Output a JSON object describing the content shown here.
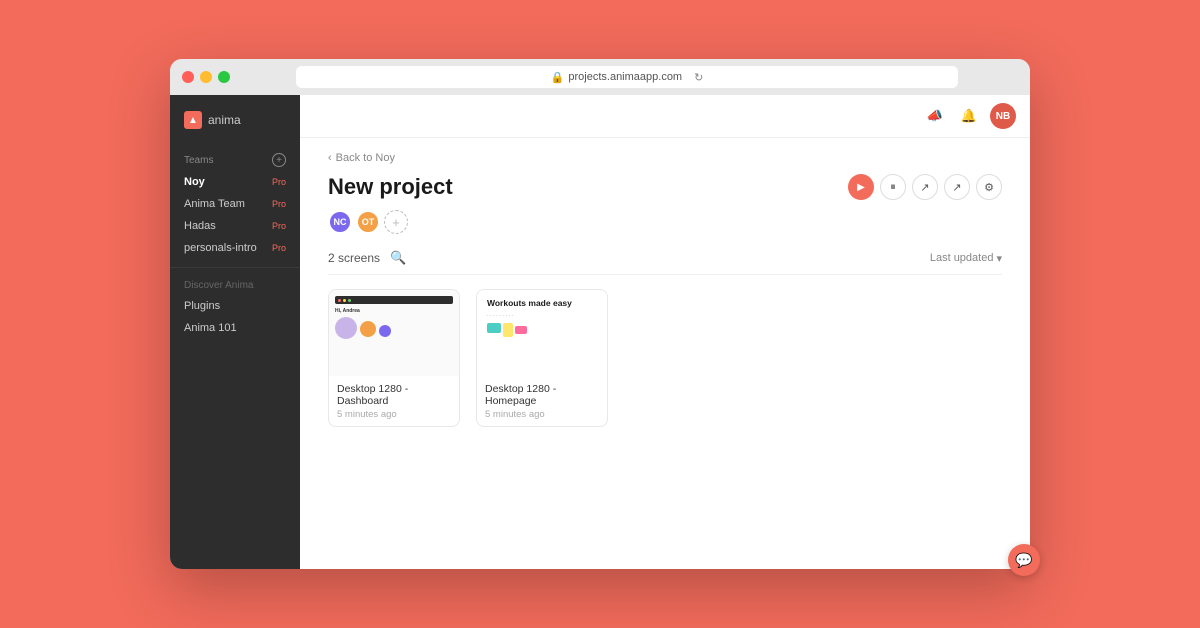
{
  "browser": {
    "url": "projects.animaapp.com",
    "traffic_lights": [
      "red",
      "yellow",
      "green"
    ]
  },
  "sidebar": {
    "logo_text": "anima",
    "teams_label": "Teams",
    "add_btn": "+",
    "items": [
      {
        "label": "Noy",
        "badge": "Pro",
        "active": true
      },
      {
        "label": "Anima Team",
        "badge": "Pro",
        "active": false
      },
      {
        "label": "Hadas",
        "badge": "Pro",
        "active": false
      },
      {
        "label": "personals-intro",
        "badge": "Pro",
        "active": false
      }
    ],
    "discover_label": "Discover Anima",
    "discover_items": [
      {
        "label": "Plugins"
      },
      {
        "label": "Anima 101"
      }
    ]
  },
  "topbar": {
    "icons": [
      "📣",
      "🔔"
    ],
    "avatar_initials": "NB"
  },
  "project": {
    "back_label": "Back to Noy",
    "title": "New project",
    "members": [
      {
        "initials": "NC",
        "color": "#7b68ee"
      },
      {
        "initials": "OT",
        "color": "#f4a046"
      }
    ],
    "add_member_label": "+",
    "screens_count": "2 screens",
    "sort_label": "Last updated",
    "sort_arrow": "▾",
    "action_btns": [
      "▶",
      "⏸",
      "↗",
      "↗",
      "⚙"
    ]
  },
  "screens": [
    {
      "name": "Desktop 1280 - Dashboard",
      "time": "5 minutes ago",
      "type": "dashboard"
    },
    {
      "name": "Desktop 1280 - Homepage",
      "time": "5 minutes ago",
      "type": "homepage",
      "thumbnail_text": "Workouts made easy"
    }
  ],
  "chat": {
    "icon": "💬"
  }
}
